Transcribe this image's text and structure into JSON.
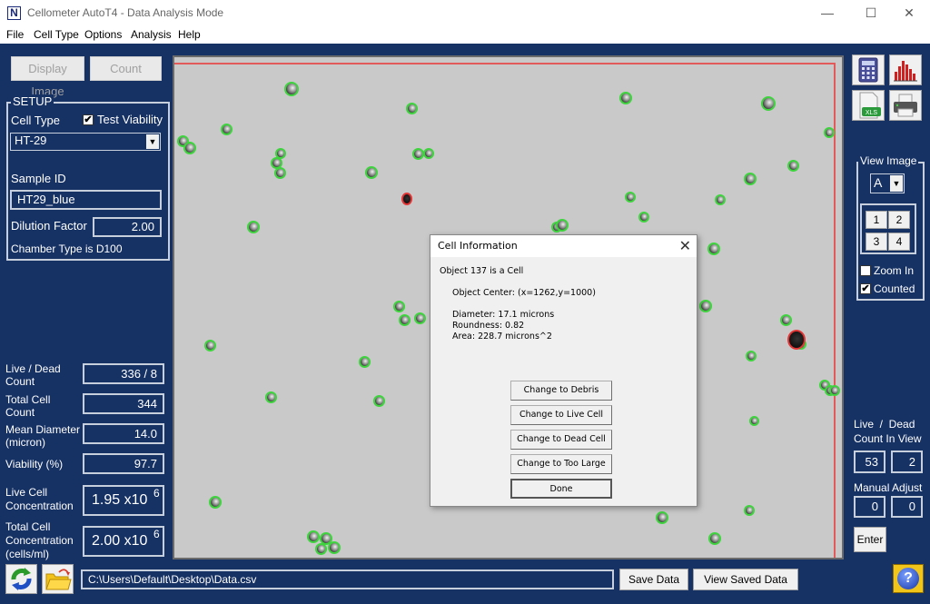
{
  "window": {
    "icon_letter": "N",
    "title": "Cellometer AutoT4 - Data Analysis Mode",
    "controls": {
      "minimize": "—",
      "maximize": "☐",
      "close": "✕"
    }
  },
  "menu": [
    "File",
    "Cell Type",
    "Options",
    "Analysis",
    "Help"
  ],
  "toolbar": {
    "display_image": "Display Image",
    "count": "Count"
  },
  "setup": {
    "title": "SETUP",
    "cell_type_label": "Cell Type",
    "test_viability_label": "Test Viability",
    "test_viability_checked": true,
    "cell_type_value": "HT-29",
    "sample_id_label": "Sample ID",
    "sample_id_value": "HT29_blue",
    "dilution_label": "Dilution Factor",
    "dilution_value": "2.00",
    "chamber_text": "Chamber Type is D100"
  },
  "results": {
    "live_dead_label_1": "Live / Dead",
    "live_dead_label_2": "Count",
    "live_dead_value": "336 / 8",
    "total_label_1": "Total Cell",
    "total_label_2": "Count",
    "total_value": "344",
    "mean_label_1": "Mean Diameter",
    "mean_label_2": "(micron)",
    "mean_value": "14.0",
    "viability_label": "Viability (%)",
    "viability_value": "97.7",
    "live_conc_label_1": "Live Cell",
    "live_conc_label_2": "Concentration",
    "live_conc_mantissa": "1.95 x10",
    "live_conc_exp": "6",
    "total_conc_label_1": "Total Cell",
    "total_conc_label_2": "Concentration",
    "total_conc_label_3": "(cells/ml)",
    "total_conc_mantissa": "2.00 x10",
    "total_conc_exp": "6"
  },
  "bottom": {
    "file_path": "C:\\Users\\Default\\Desktop\\Data.csv",
    "save_data": "Save Data",
    "view_saved_data": "View Saved Data",
    "help_glyph": "?"
  },
  "right_panel": {
    "xls_label": "XLS",
    "view_image_title": "View Image",
    "view_image_value": "A",
    "quadrants": [
      "1",
      "2",
      "3",
      "4"
    ],
    "zoom_in_label": "Zoom In",
    "zoom_in_checked": false,
    "counted_label": "Counted",
    "counted_checked": true,
    "count_in_view_label_1": "Live  /  Dead",
    "count_in_view_label_2": "Count In View",
    "live_in_view": "53",
    "dead_in_view": "2",
    "manual_adjust_label": "Manual Adjust",
    "manual_live": "0",
    "manual_dead": "0",
    "enter": "Enter"
  },
  "dialog": {
    "title": "Cell Information",
    "close_glyph": "✕",
    "object_line": "Object 137 is a Cell",
    "center_line": "Object Center: (x=1262,y=1000)",
    "diameter_line": "Diameter: 17.1 microns",
    "roundness_line": "Roundness: 0.82",
    "area_line": "Area: 228.7 microns^2",
    "buttons": [
      "Change to Debris",
      "Change to Live Cell",
      "Change to Dead Cell",
      "Change to Too Large",
      "Done"
    ]
  },
  "image": {
    "live_outline_color": "#3ed43e",
    "dead_outline_color": "#e23434"
  }
}
